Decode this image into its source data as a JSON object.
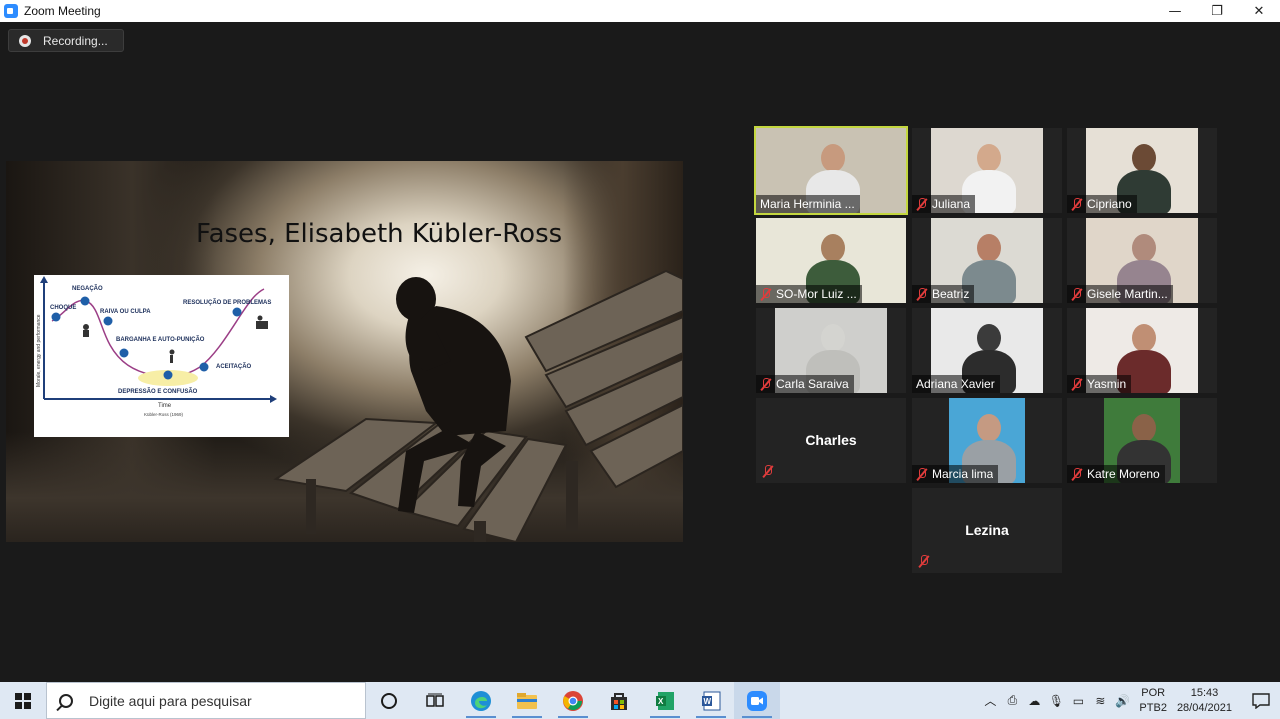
{
  "window": {
    "title": "Zoom Meeting",
    "minimize": "—",
    "restore": "❐",
    "close": "✕"
  },
  "recording": {
    "label": "Recording..."
  },
  "slide": {
    "title": "Fases, Elisabeth Kübler-Ross",
    "chart": {
      "labels": {
        "negacao": "NEGAÇÃO",
        "choque": "CHOQUE",
        "raiva": "RAIVA OU CULPA",
        "barganha": "BARGANHA E AUTO-PUNIÇÃO",
        "depressao": "DEPRESSÃO E CONFUSÃO",
        "aceitacao": "ACEITAÇÃO",
        "resolucao": "RESOLUÇÃO DE PROBLEMAS",
        "ylabel": "Morale, energy and performance",
        "xlabel": "Time",
        "source": "Kübler-Ross (1969)"
      }
    }
  },
  "participants": [
    {
      "name": "Maria Herminia ...",
      "muted": false,
      "active": true,
      "bg": "#c9c2b3",
      "skin": "#c79a7e",
      "shirt": "#e8e8e8"
    },
    {
      "name": "Juliana",
      "muted": true,
      "active": false,
      "bg": "#ddd8d0",
      "skin": "#d3a98c",
      "shirt": "#f2f2f2"
    },
    {
      "name": "Cipriano",
      "muted": true,
      "active": false,
      "bg": "#e6e0d6",
      "skin": "#6b4a35",
      "shirt": "#2f3b34"
    },
    {
      "name": "SO-Mor Luiz ...",
      "muted": true,
      "active": false,
      "bg": "#e8e6d8",
      "skin": "#a8805f",
      "shirt": "#3d5c3b"
    },
    {
      "name": "Beatriz",
      "muted": true,
      "active": false,
      "bg": "#dcdad3",
      "skin": "#b77f66",
      "shirt": "#7c8a8e"
    },
    {
      "name": "Gisele Martin...",
      "muted": true,
      "active": false,
      "bg": "#e0d6c9",
      "skin": "#b08b7c",
      "shirt": "#96848f"
    },
    {
      "name": "Carla Saraiva",
      "muted": true,
      "active": false,
      "bg": "#cfcfcc",
      "skin": "#d4d4d0",
      "shirt": "#bfbfbb"
    },
    {
      "name": "Adriana Xavier",
      "muted": false,
      "active": false,
      "bg": "#e9e9e9",
      "skin": "#3b3b3b",
      "shirt": "#2c2c2c"
    },
    {
      "name": "Yasmin",
      "muted": true,
      "active": false,
      "bg": "#eeeae6",
      "skin": "#c08f74",
      "shirt": "#6b2b2b"
    },
    {
      "name": "Charles",
      "muted": true,
      "active": false,
      "avatar_only": true
    },
    {
      "name": "Marcia lima",
      "muted": true,
      "active": false,
      "bg": "#4aa6d6",
      "skin": "#c59a82",
      "shirt": "#9aa0a5"
    },
    {
      "name": "Katre Moreno",
      "muted": true,
      "active": false,
      "bg": "#3f7b3b",
      "skin": "#8a6248",
      "shirt": "#333333"
    },
    {
      "name": "Lezina",
      "muted": true,
      "active": false,
      "avatar_only": true
    }
  ],
  "taskbar": {
    "search_placeholder": "Digite aqui para pesquisar",
    "apps": [
      "task-view",
      "edge",
      "file-explorer",
      "chrome",
      "store",
      "excel",
      "word",
      "zoom"
    ],
    "language": "POR",
    "keyboard": "PTB2",
    "time": "15:43",
    "date": "28/04/2021"
  },
  "colors": {
    "active_speaker": "#c4d73f",
    "muted_red": "#e03c3c",
    "chart_line": "#9b3e86",
    "chart_point": "#1f5fa8"
  }
}
